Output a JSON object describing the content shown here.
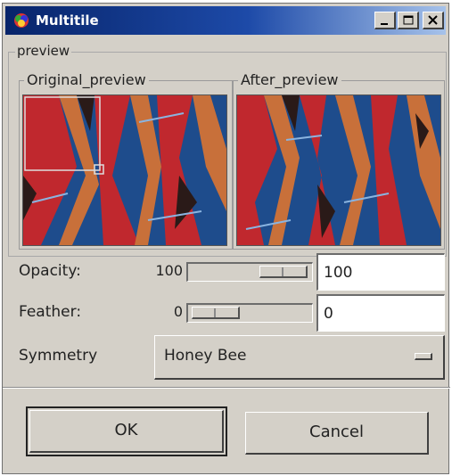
{
  "window": {
    "title": "Multitile"
  },
  "preview": {
    "group_label": "preview",
    "original_label": "Original_preview",
    "after_label": "After_preview"
  },
  "opacity": {
    "label": "Opacity:",
    "min_label": "100",
    "value": "100"
  },
  "feather": {
    "label": "Feather:",
    "min_label": "0",
    "value": "0"
  },
  "symmetry": {
    "label": "Symmetry",
    "selected": "Honey Bee"
  },
  "buttons": {
    "ok": "OK",
    "cancel": "Cancel"
  },
  "colors": {
    "title_start": "#07246a",
    "title_end": "#a6c2ea",
    "pattern_blue": "#1e4c8c",
    "pattern_red": "#c0282e",
    "pattern_skin": "#c8703a"
  },
  "icons": [
    "app-icon",
    "minimize-icon",
    "maximize-icon",
    "close-icon",
    "dropdown-indicator-icon"
  ]
}
